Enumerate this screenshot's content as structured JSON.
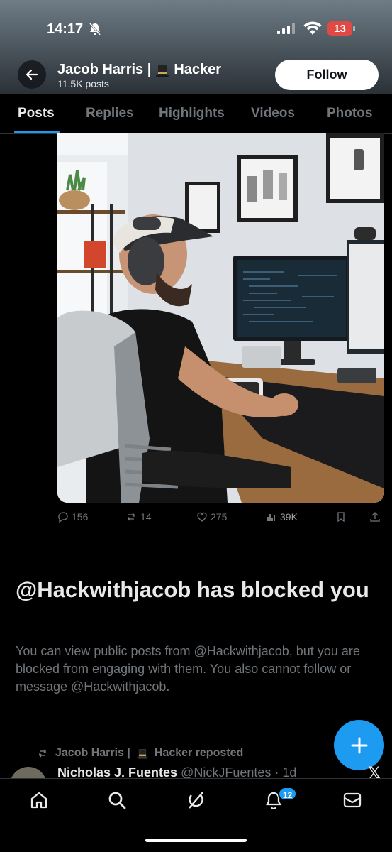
{
  "status_bar": {
    "time": "14:17",
    "battery": "13",
    "icons": [
      "bell-off-icon",
      "signal-icon",
      "wifi-icon",
      "battery-icon"
    ]
  },
  "header": {
    "profile_name": "Jacob Harris |",
    "profile_suffix": "Hacker",
    "post_count": "11.5K posts",
    "follow_label": "Follow"
  },
  "tabs": [
    {
      "label": "Posts",
      "active": true
    },
    {
      "label": "Replies",
      "active": false
    },
    {
      "label": "Highlights",
      "active": false
    },
    {
      "label": "Videos",
      "active": false
    },
    {
      "label": "Photos",
      "active": false
    }
  ],
  "post": {
    "replies": "156",
    "reposts": "14",
    "likes": "275",
    "views": "39K"
  },
  "blocked": {
    "title": "@Hackwithjacob has blocked you",
    "body": "You can view public posts from @Hackwithjacob, but you are blocked from engaging with them. You also cannot follow or message @Hackwithjacob."
  },
  "next_post": {
    "repost_by": "Jacob Harris |",
    "repost_suffix": "Hacker reposted",
    "author": "Nicholas J. Fuentes",
    "handle": "@NickJFuentes · 1d"
  },
  "bottom_nav": {
    "items": [
      "home-icon",
      "search-icon",
      "grok-icon",
      "notifications-icon",
      "messages-icon"
    ],
    "notification_badge": "12"
  },
  "colors": {
    "accent": "#1d9bf0",
    "background": "#000000",
    "muted_text": "#71767b"
  }
}
